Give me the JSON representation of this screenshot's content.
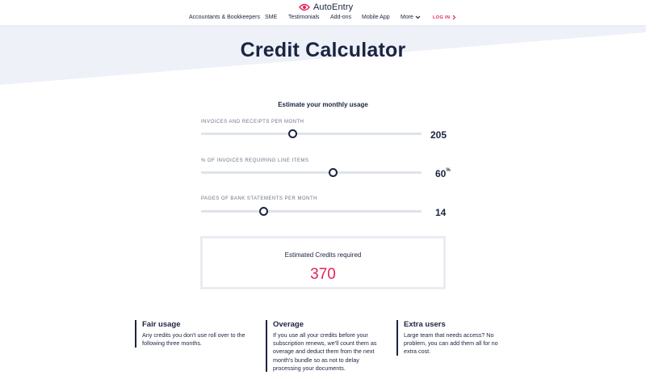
{
  "header": {
    "logo_text": "AutoEntry",
    "nav": [
      {
        "label": "Accountants & Bookkeepers"
      },
      {
        "label": "SME"
      },
      {
        "label": "Testimonials"
      },
      {
        "label": "Add-ons"
      },
      {
        "label": "Mobile App"
      },
      {
        "label": "More"
      }
    ],
    "login_label": "LOG IN"
  },
  "page": {
    "title": "Credit Calculator",
    "subtitle": "Estimate your monthly usage"
  },
  "sliders": [
    {
      "label": "INVOICES AND RECEIPTS PER MONTH",
      "value": "205",
      "fraction": 0.415
    },
    {
      "label": "% OF INVOICES REQUIRING LINE ITEMS",
      "value": "60",
      "suffix": "%",
      "fraction": 0.6
    },
    {
      "label": "PAGES OF BANK STATEMENTS PER MONTH",
      "value": "14",
      "fraction": 0.285
    }
  ],
  "result": {
    "label": "Estimated Credits required",
    "value": "370"
  },
  "info": [
    {
      "title": "Fair usage",
      "text": "Any credits you don't use roll over to the following three months."
    },
    {
      "title": "Overage",
      "text": "If you use all your credits before your subscription renews, we'll count them as overage and deduct them from the next month's bundle so as not to delay processing your documents."
    },
    {
      "title": "Extra users",
      "text": "Large team that needs access? No problem, you can add them all for no extra cost."
    }
  ],
  "colors": {
    "brand": "#e0245e",
    "navy": "#1b2440",
    "background_shape": "#eef1f8"
  }
}
